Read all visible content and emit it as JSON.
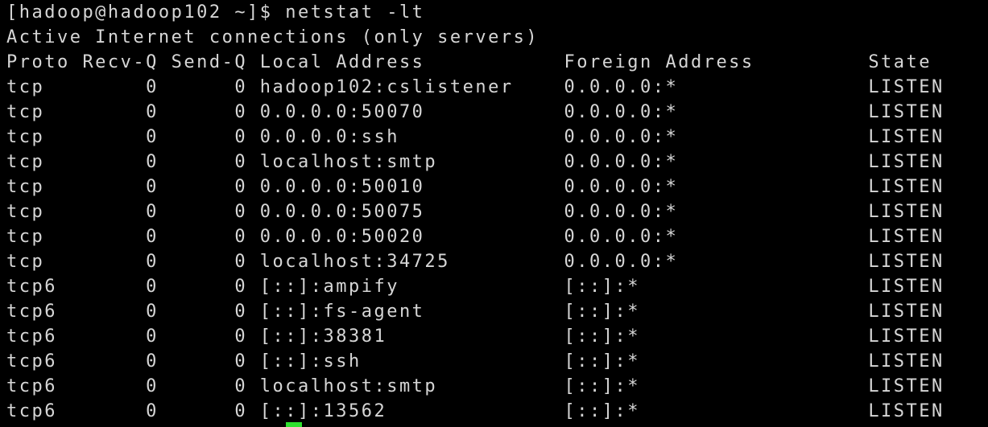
{
  "terminal": {
    "background_color": "#000000",
    "foreground_color": "#d6d6d6",
    "cursor_color": "#2ee02e",
    "prompt_line": "[hadoop@hadoop102 ~]$ netstat -lt",
    "banner_line": "Active Internet connections (only servers)",
    "columns": {
      "proto": "Proto",
      "recv_q": "Recv-Q",
      "send_q": "Send-Q",
      "local_address": "Local Address",
      "foreign_address": "Foreign Address",
      "state": "State"
    },
    "header_line": "Proto Recv-Q Send-Q Local Address           Foreign Address         State",
    "rows": [
      {
        "proto": "tcp",
        "recv_q": "0",
        "send_q": "0",
        "local_address": "hadoop102:cslistener",
        "foreign_address": "0.0.0.0:*",
        "state": "LISTEN",
        "line": "tcp        0      0 hadoop102:cslistener    0.0.0.0:*               LISTEN"
      },
      {
        "proto": "tcp",
        "recv_q": "0",
        "send_q": "0",
        "local_address": "0.0.0.0:50070",
        "foreign_address": "0.0.0.0:*",
        "state": "LISTEN",
        "line": "tcp        0      0 0.0.0.0:50070           0.0.0.0:*               LISTEN"
      },
      {
        "proto": "tcp",
        "recv_q": "0",
        "send_q": "0",
        "local_address": "0.0.0.0:ssh",
        "foreign_address": "0.0.0.0:*",
        "state": "LISTEN",
        "line": "tcp        0      0 0.0.0.0:ssh             0.0.0.0:*               LISTEN"
      },
      {
        "proto": "tcp",
        "recv_q": "0",
        "send_q": "0",
        "local_address": "localhost:smtp",
        "foreign_address": "0.0.0.0:*",
        "state": "LISTEN",
        "line": "tcp        0      0 localhost:smtp          0.0.0.0:*               LISTEN"
      },
      {
        "proto": "tcp",
        "recv_q": "0",
        "send_q": "0",
        "local_address": "0.0.0.0:50010",
        "foreign_address": "0.0.0.0:*",
        "state": "LISTEN",
        "line": "tcp        0      0 0.0.0.0:50010           0.0.0.0:*               LISTEN"
      },
      {
        "proto": "tcp",
        "recv_q": "0",
        "send_q": "0",
        "local_address": "0.0.0.0:50075",
        "foreign_address": "0.0.0.0:*",
        "state": "LISTEN",
        "line": "tcp        0      0 0.0.0.0:50075           0.0.0.0:*               LISTEN"
      },
      {
        "proto": "tcp",
        "recv_q": "0",
        "send_q": "0",
        "local_address": "0.0.0.0:50020",
        "foreign_address": "0.0.0.0:*",
        "state": "LISTEN",
        "line": "tcp        0      0 0.0.0.0:50020           0.0.0.0:*               LISTEN"
      },
      {
        "proto": "tcp",
        "recv_q": "0",
        "send_q": "0",
        "local_address": "localhost:34725",
        "foreign_address": "0.0.0.0:*",
        "state": "LISTEN",
        "line": "tcp        0      0 localhost:34725         0.0.0.0:*               LISTEN"
      },
      {
        "proto": "tcp6",
        "recv_q": "0",
        "send_q": "0",
        "local_address": "[::]:ampify",
        "foreign_address": "[::]:*",
        "state": "LISTEN",
        "line": "tcp6       0      0 [::]:ampify             [::]:*                  LISTEN"
      },
      {
        "proto": "tcp6",
        "recv_q": "0",
        "send_q": "0",
        "local_address": "[::]:fs-agent",
        "foreign_address": "[::]:*",
        "state": "LISTEN",
        "line": "tcp6       0      0 [::]:fs-agent           [::]:*                  LISTEN"
      },
      {
        "proto": "tcp6",
        "recv_q": "0",
        "send_q": "0",
        "local_address": "[::]:38381",
        "foreign_address": "[::]:*",
        "state": "LISTEN",
        "line": "tcp6       0      0 [::]:38381              [::]:*                  LISTEN"
      },
      {
        "proto": "tcp6",
        "recv_q": "0",
        "send_q": "0",
        "local_address": "[::]:ssh",
        "foreign_address": "[::]:*",
        "state": "LISTEN",
        "line": "tcp6       0      0 [::]:ssh                [::]:*                  LISTEN"
      },
      {
        "proto": "tcp6",
        "recv_q": "0",
        "send_q": "0",
        "local_address": "localhost:smtp",
        "foreign_address": "[::]:*",
        "state": "LISTEN",
        "line": "tcp6       0      0 localhost:smtp          [::]:*                  LISTEN"
      },
      {
        "proto": "tcp6",
        "recv_q": "0",
        "send_q": "0",
        "local_address": "[::]:13562",
        "foreign_address": "[::]:*",
        "state": "LISTEN",
        "line": "tcp6       0      0 [::]:13562              [::]:*                  LISTEN"
      }
    ]
  }
}
